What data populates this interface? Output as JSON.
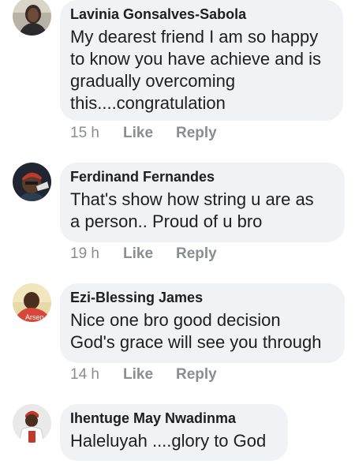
{
  "comments": [
    {
      "author": "Lavinia Gonsalves-Sabola",
      "text_lines": [
        "My dearest friend I am so happy",
        "to know you have achieve and is",
        "gradually overcoming",
        "this....congratulation"
      ],
      "time": "15 h",
      "like_label": "Like",
      "reply_label": "Reply",
      "avatar_icon": "profile-photo-icon"
    },
    {
      "author": "Ferdinand Fernandes",
      "text_lines": [
        "That's show how string u are as",
        "a person.. Proud of u bro"
      ],
      "time": "19 h",
      "like_label": "Like",
      "reply_label": "Reply",
      "avatar_icon": "profile-photo-icon"
    },
    {
      "author": "Ezi-Blessing James",
      "text_lines": [
        "Nice one bro good decision",
        "God's grace will see you through"
      ],
      "time": "14 h",
      "like_label": "Like",
      "reply_label": "Reply",
      "avatar_icon": "profile-photo-icon",
      "avatar_text": "Arsen"
    },
    {
      "author": "Ihentuge May Nwadinma",
      "text_lines": [
        "Haleluyah ....glory to God"
      ],
      "avatar_icon": "profile-photo-icon"
    }
  ],
  "colors": {
    "bubble_background": "#f0f2f5",
    "text": "#1c1e21",
    "meta": "#8a8d91"
  }
}
